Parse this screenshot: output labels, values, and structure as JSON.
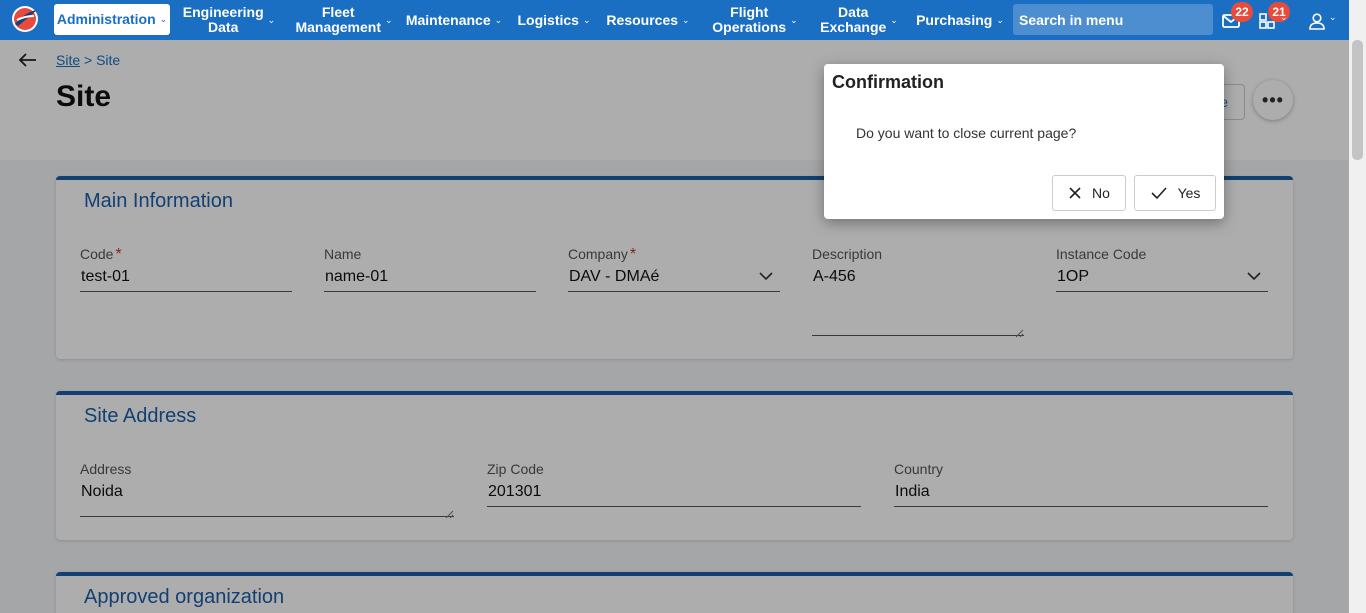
{
  "nav": {
    "active": {
      "label": "Administration",
      "icon": "chevron-down-icon"
    },
    "items": [
      {
        "line1": "Engineering",
        "line2": "Data"
      },
      {
        "line1": "Fleet",
        "line2": "Management"
      },
      {
        "line1": "Maintenance",
        "line2": ""
      },
      {
        "line1": "Logistics",
        "line2": ""
      },
      {
        "line1": "Resources",
        "line2": ""
      },
      {
        "line1": "Flight",
        "line2": "Operations"
      },
      {
        "line1": "Data",
        "line2": "Exchange"
      },
      {
        "line1": "Purchasing",
        "line2": ""
      }
    ],
    "search_placeholder": "Search in menu",
    "mail_badge": "22",
    "tasks_badge": "21"
  },
  "breadcrumb": {
    "link": "Site",
    "separator": ">",
    "current": "Site"
  },
  "page_title": "Site",
  "header_button_partial": "e",
  "main_info": {
    "title": "Main Information",
    "code": {
      "label": "Code",
      "value": "test-01"
    },
    "name": {
      "label": "Name",
      "value": "name-01"
    },
    "company": {
      "label": "Company",
      "value": "DAV - DMAé"
    },
    "description": {
      "label": "Description",
      "value": "A-456"
    },
    "instance_code": {
      "label": "Instance Code",
      "value": "1OP"
    }
  },
  "site_address": {
    "title": "Site Address",
    "address": {
      "label": "Address",
      "value": "Noida"
    },
    "zip": {
      "label": "Zip Code",
      "value": "201301"
    },
    "country": {
      "label": "Country",
      "value": "India"
    }
  },
  "approved_org": {
    "title": "Approved organization"
  },
  "dialog": {
    "title": "Confirmation",
    "message": "Do you want to close current page?",
    "no_label": "No",
    "yes_label": "Yes"
  },
  "colors": {
    "nav_bg": "#1b6fc3",
    "card_accent": "#1b5fa8",
    "badge": "#e84b3c"
  }
}
